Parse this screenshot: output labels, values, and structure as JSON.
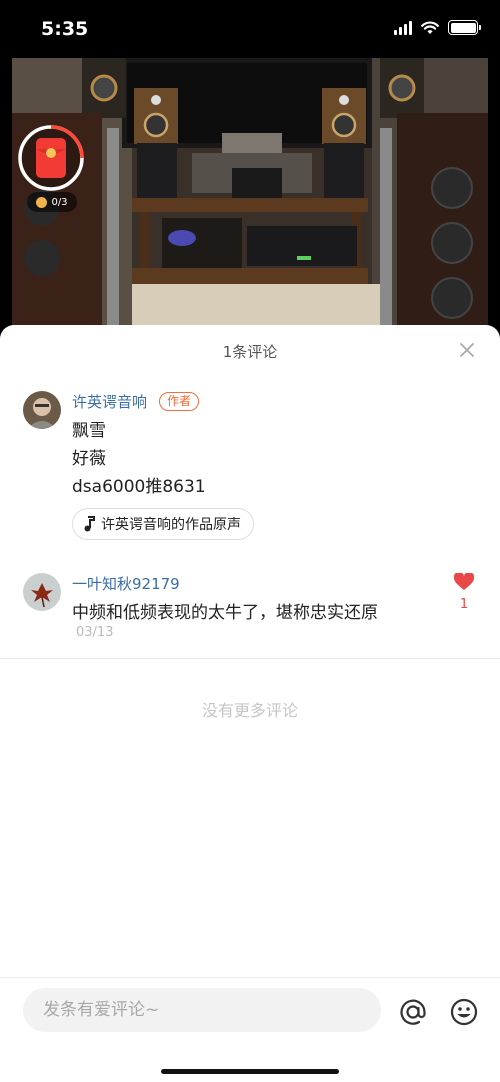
{
  "status_bar": {
    "time": "5:35"
  },
  "red_packet": {
    "progress_text": "0/3"
  },
  "comments_panel": {
    "title": "1条评论",
    "comments": [
      {
        "author": "许英谔音响",
        "badge": "作者",
        "lines": [
          "飘雪",
          "好薇",
          "dsa6000推8631"
        ],
        "sound_label": "许英谔音响的作品原声"
      },
      {
        "author": "一叶知秋92179",
        "text": "中频和低频表现的太牛了，堪称忠实还原",
        "date": "03/13",
        "likes": "1"
      }
    ],
    "no_more_text": "没有更多评论"
  },
  "input": {
    "placeholder": "发条有爱评论~"
  },
  "colors": {
    "author_name": "#3b6ea5",
    "badge": "#f06d3c",
    "like": "#e84848"
  }
}
